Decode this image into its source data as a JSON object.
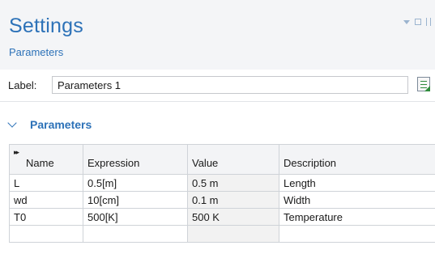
{
  "header": {
    "title": "Settings",
    "subtitle": "Parameters",
    "window_controls": [
      "dropdown-icon",
      "maximize-icon",
      "pin-icon"
    ]
  },
  "label_field": {
    "label": "Label:",
    "value": "Parameters 1",
    "icon": "edit-label-icon"
  },
  "section": {
    "title": "Parameters",
    "expanded": true
  },
  "table": {
    "columns": [
      "Name",
      "Expression",
      "Value",
      "Description"
    ],
    "rows": [
      [
        "L",
        "0.5[m]",
        "0.5 m",
        "Length"
      ],
      [
        "wd",
        "10[cm]",
        "0.1 m",
        "Width"
      ],
      [
        "T0",
        "500[K]",
        "500 K",
        "Temperature"
      ],
      [
        "",
        "",
        "",
        ""
      ]
    ]
  },
  "colors": {
    "accent": "#2d72b8",
    "header_bg": "#f4f5f7",
    "grid": "#cfd3d8"
  }
}
